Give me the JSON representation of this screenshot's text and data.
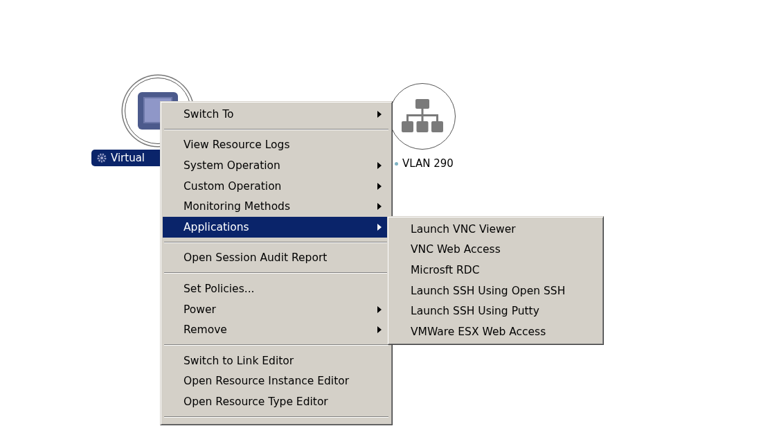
{
  "nodes": [
    {
      "kind": "vm",
      "label": "Virtual",
      "selected": true
    },
    {
      "kind": "network",
      "label": "VLAN 290",
      "selected": false
    }
  ],
  "context_menu": {
    "items": [
      {
        "kind": "item",
        "label": "Switch To",
        "has_submenu": true,
        "selected": false
      },
      {
        "kind": "separator"
      },
      {
        "kind": "item",
        "label": "View Resource Logs",
        "has_submenu": false,
        "selected": false
      },
      {
        "kind": "item",
        "label": "System Operation",
        "has_submenu": true,
        "selected": false
      },
      {
        "kind": "item",
        "label": "Custom Operation",
        "has_submenu": true,
        "selected": false
      },
      {
        "kind": "item",
        "label": "Monitoring Methods",
        "has_submenu": true,
        "selected": false
      },
      {
        "kind": "item",
        "label": "Applications",
        "has_submenu": true,
        "selected": true
      },
      {
        "kind": "separator"
      },
      {
        "kind": "item",
        "label": "Open Session Audit Report",
        "has_submenu": false,
        "selected": false
      },
      {
        "kind": "separator"
      },
      {
        "kind": "item",
        "label": "Set Policies...",
        "has_submenu": false,
        "selected": false
      },
      {
        "kind": "item",
        "label": "Power",
        "has_submenu": true,
        "selected": false
      },
      {
        "kind": "item",
        "label": "Remove",
        "has_submenu": true,
        "selected": false
      },
      {
        "kind": "separator"
      },
      {
        "kind": "item",
        "label": "Switch to Link Editor",
        "has_submenu": false,
        "selected": false
      },
      {
        "kind": "item",
        "label": "Open Resource Instance Editor",
        "has_submenu": false,
        "selected": false
      },
      {
        "kind": "item",
        "label": "Open Resource Type Editor",
        "has_submenu": false,
        "selected": false
      },
      {
        "kind": "separator"
      }
    ]
  },
  "submenu": {
    "items": [
      {
        "kind": "item",
        "label": "Launch VNC Viewer",
        "has_submenu": false,
        "selected": false
      },
      {
        "kind": "item",
        "label": "VNC Web Access",
        "has_submenu": false,
        "selected": false
      },
      {
        "kind": "item",
        "label": "Microsft RDC",
        "has_submenu": false,
        "selected": false
      },
      {
        "kind": "item",
        "label": "Launch SSH Using Open SSH",
        "has_submenu": false,
        "selected": false
      },
      {
        "kind": "item",
        "label": "Launch SSH Using Putty",
        "has_submenu": false,
        "selected": false
      },
      {
        "kind": "item",
        "label": "VMWare ESX Web Access",
        "has_submenu": false,
        "selected": false
      }
    ]
  }
}
